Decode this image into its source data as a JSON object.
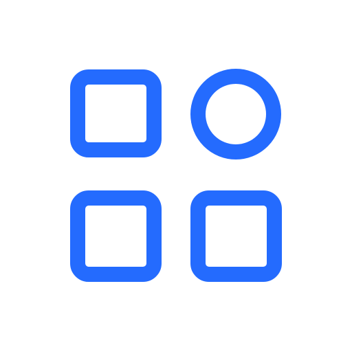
{
  "icon": {
    "name": "apps-grid-icon",
    "color": "#246BFE",
    "background": "#FFFFFF",
    "cells": [
      {
        "shape": "rounded-square",
        "name": "top-left-square"
      },
      {
        "shape": "circle",
        "name": "top-right-circle"
      },
      {
        "shape": "rounded-square",
        "name": "bottom-left-square"
      },
      {
        "shape": "rounded-square",
        "name": "bottom-right-square"
      }
    ]
  }
}
